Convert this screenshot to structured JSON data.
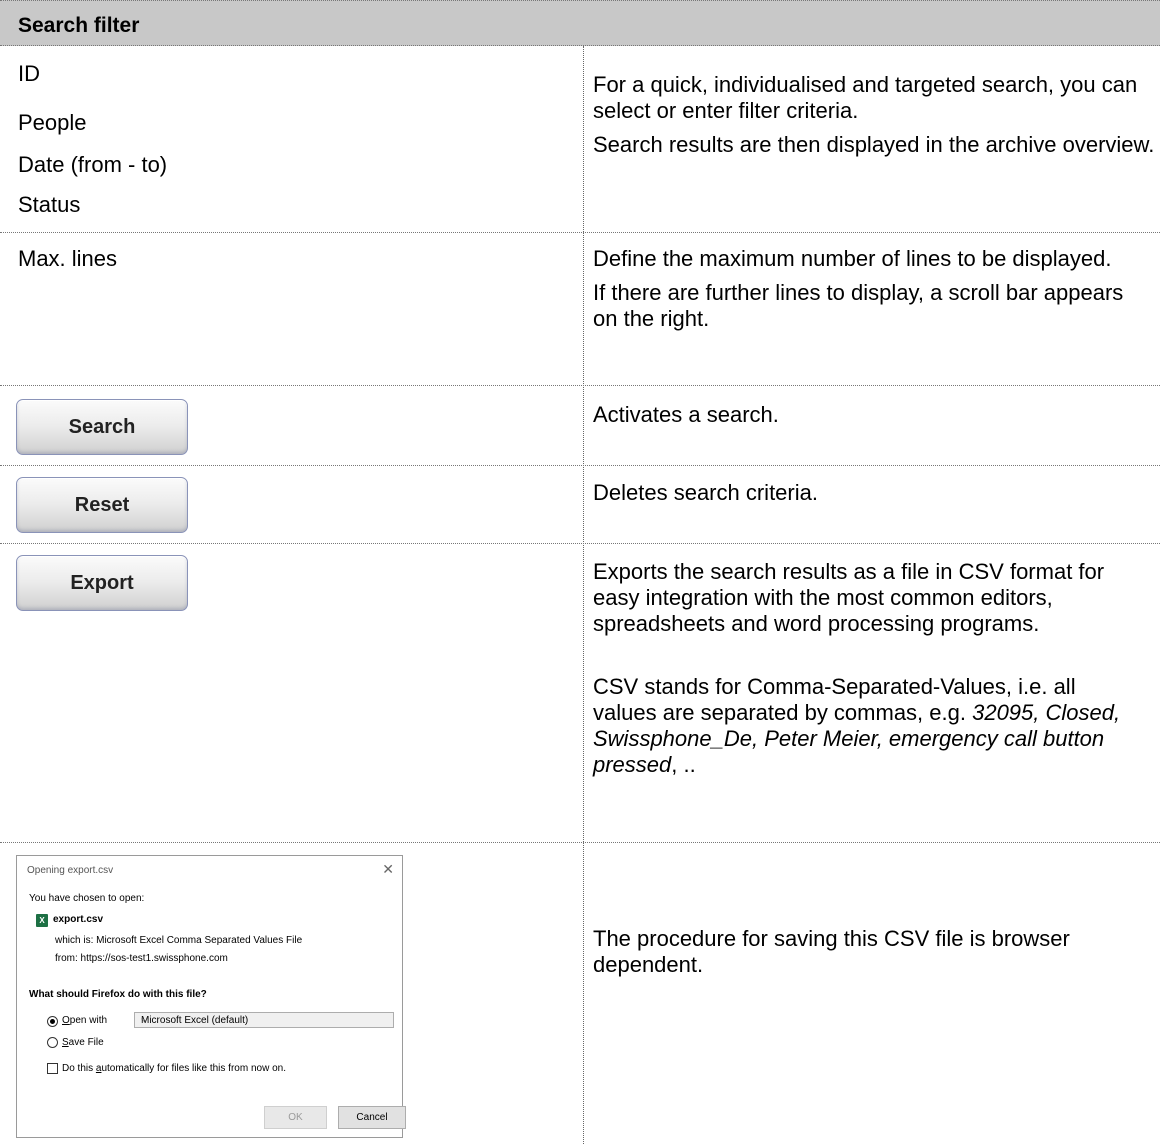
{
  "header": {
    "title": "Search filter"
  },
  "rows": {
    "filters": {
      "labels": [
        "ID",
        "People",
        "Date (from - to)",
        "Status"
      ],
      "desc": [
        "For a quick, individualised and targeted search, you can select or enter filter criteria.",
        "Search results are then displayed in the archive overview."
      ]
    },
    "max_lines": {
      "label": "Max. lines",
      "desc": [
        "Define the maximum number of lines to be displayed.",
        "If there are further lines to display, a scroll bar appears on the right."
      ]
    },
    "search": {
      "button": "Search",
      "desc": "Activates a search."
    },
    "reset": {
      "button": "Reset",
      "desc": "Deletes search criteria."
    },
    "export": {
      "button": "Export",
      "desc1": "Exports the search results as a file in CSV format for easy integration with the most common editors, spreadsheets and word processing programs.",
      "desc2_prefix": "CSV stands for Comma-Separated-Values, i.e. all values are separated by commas, e.g. ",
      "desc2_example": "32095, Closed, Swissphone_De, Peter Meier, emergency call button pressed",
      "desc2_suffix": ", .."
    },
    "dialog_row": {
      "desc": "The procedure for saving this CSV file is browser dependent."
    }
  },
  "dialog": {
    "title": "Opening export.csv",
    "close_icon": "close-icon",
    "intro": "You have chosen to open:",
    "file_icon": "excel-file-icon",
    "filename": "export.csv",
    "which_is": "which is:  Microsoft Excel Comma Separated Values File",
    "from": "from:  https://sos-test1.swissphone.com",
    "question": "What should Firefox do with this file?",
    "open_with_label": "Open with",
    "open_with_value": "Microsoft Excel (default)",
    "save_file_label": "Save File",
    "auto_label": "Do this automatically for files like this from now on.",
    "ok_label": "OK",
    "cancel_label": "Cancel",
    "selected_option": "Open with",
    "auto_checked": false
  }
}
